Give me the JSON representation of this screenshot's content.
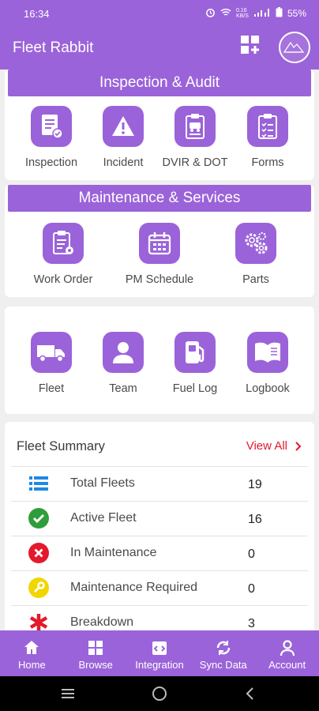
{
  "status_bar": {
    "time": "16:34",
    "network": "0.16 KB/S",
    "battery": "55%"
  },
  "app_bar": {
    "title": "Fleet Rabbit",
    "add_icon": "grid-plus-icon",
    "avatar_icon": "truck-logo-avatar"
  },
  "inspection_audit": {
    "header": "Inspection & Audit",
    "items": [
      {
        "label": "Inspection",
        "icon": "inspection-doc-icon"
      },
      {
        "label": "Incident",
        "icon": "warning-icon"
      },
      {
        "label": "DVIR & DOT",
        "icon": "dvir-clipboard-icon"
      },
      {
        "label": "Forms",
        "icon": "forms-checklist-icon"
      }
    ]
  },
  "maintenance_services": {
    "header": "Maintenance & Services",
    "items": [
      {
        "label": "Work Order",
        "icon": "work-order-icon"
      },
      {
        "label": "PM Schedule",
        "icon": "calendar-icon"
      },
      {
        "label": "Parts",
        "icon": "gears-icon"
      }
    ]
  },
  "resources": {
    "items": [
      {
        "label": "Fleet",
        "icon": "truck-icon"
      },
      {
        "label": "Team",
        "icon": "person-icon"
      },
      {
        "label": "Fuel Log",
        "icon": "fuel-pump-icon"
      },
      {
        "label": "Logbook",
        "icon": "book-icon"
      }
    ]
  },
  "fleet_summary": {
    "title": "Fleet Summary",
    "view_all": "View All",
    "rows": [
      {
        "label": "Total Fleets",
        "value": "19",
        "icon": "list-icon",
        "color": "#1e88e5"
      },
      {
        "label": "Active Fleet",
        "value": "16",
        "icon": "check-circle-icon",
        "color": "#2e9e3a"
      },
      {
        "label": "In Maintenance",
        "value": "0",
        "icon": "x-circle-icon",
        "color": "#e3192c"
      },
      {
        "label": "Maintenance Required",
        "value": "0",
        "icon": "wrench-circle-icon",
        "color": "#f2d600"
      },
      {
        "label": "Breakdown",
        "value": "3",
        "icon": "asterisk-icon",
        "color": "#e3192c"
      }
    ]
  },
  "bottom_nav": [
    {
      "label": "Home",
      "icon": "home-icon"
    },
    {
      "label": "Browse",
      "icon": "browse-icon"
    },
    {
      "label": "Integration",
      "icon": "integration-icon"
    },
    {
      "label": "Sync Data",
      "icon": "sync-icon"
    },
    {
      "label": "Account",
      "icon": "account-icon"
    }
  ],
  "colors": {
    "primary": "#9b63d9",
    "background": "#efefef",
    "accent_red": "#e3192c"
  }
}
